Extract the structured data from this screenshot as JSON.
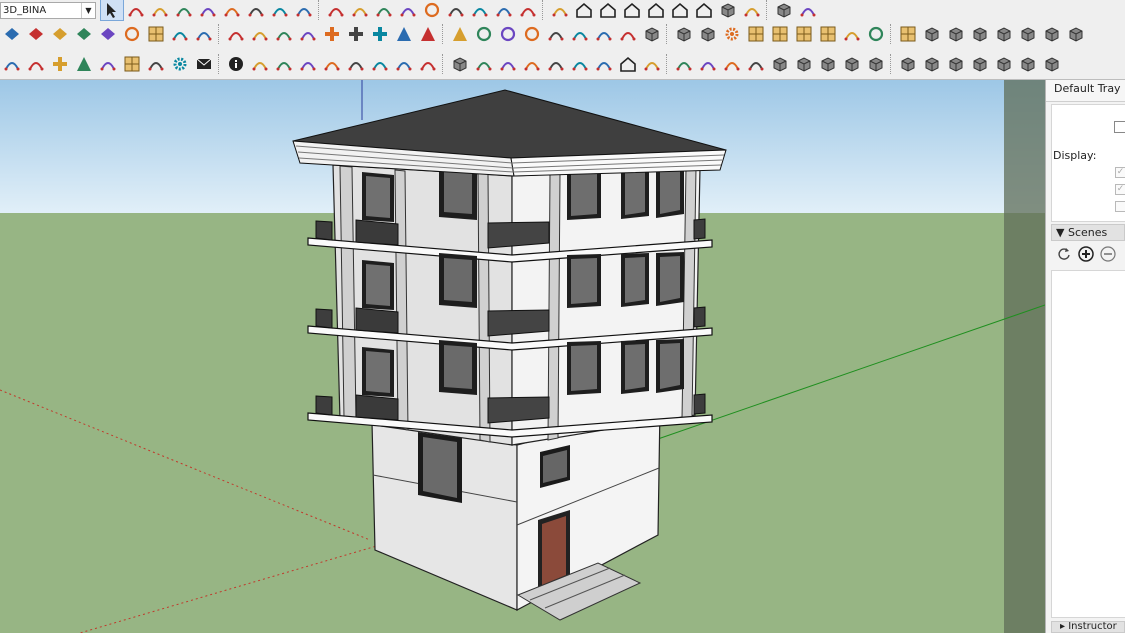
{
  "toolbar": {
    "layer_value": "3D_BINA",
    "row1_icons": [
      "select-icon",
      "eraser-icon",
      "pencil-line-icon",
      "arc-icon",
      "paint-bucket-icon",
      "push-pull-icon",
      "move-icon",
      "rotate-icon",
      "offset-icon",
      "tape-measure-icon",
      "protractor-icon",
      "text-icon",
      "axes-icon",
      "orbit-icon",
      "pan-icon",
      "zoom-icon",
      "zoom-extents-icon",
      "section-plane-icon",
      "styles-icon",
      "iso-view-icon",
      "top-view-icon",
      "front-view-icon",
      "right-view-icon",
      "back-view-icon",
      "left-view-icon",
      "layers-icon",
      "solid-tools-icon",
      "sandbox-icon",
      "paint-icon"
    ],
    "row2_icons": [
      "diamond-icon",
      "diamond-icon",
      "diamond-icon",
      "diamond-icon",
      "diamond-icon",
      "ring-icon",
      "table-icon",
      "copy-icon",
      "copy-icon",
      "weld-icon",
      "magnet-icon",
      "bracket-icon",
      "curve-icon",
      "cross-icon",
      "cross-icon",
      "cross-icon",
      "cone-icon",
      "cone-icon",
      "triangle-icon",
      "spiral-icon",
      "spiral-icon",
      "spiral-icon",
      "star-icon",
      "cylinder-icon",
      "undo-curve-icon",
      "puzzle-icon",
      "box-icon",
      "box-icon",
      "box-icon",
      "gear-icon",
      "grid-icon",
      "grid-icon",
      "grid-icon",
      "grid-icon",
      "dots-icon",
      "circle-dots-icon",
      "grid-icon",
      "stack-icon",
      "stack-icon",
      "stack-icon",
      "stack-icon",
      "stack-icon",
      "stack-icon",
      "stack-icon"
    ],
    "row3_icons": [
      "refresh-icon",
      "arrows-icon",
      "plus-icon",
      "tree-icon",
      "sun-icon",
      "checker-icon",
      "cloud-icon",
      "gear-icon",
      "mail-icon",
      "info-icon",
      "nodes-icon",
      "nodes-icon",
      "nodes-icon",
      "knife-icon",
      "flower-icon",
      "fish-icon",
      "pipe-icon",
      "curve-icon",
      "box-icon",
      "shell-icon",
      "bend-icon",
      "corner-icon",
      "corner-icon",
      "line-icon",
      "fill-icon",
      "house-icon",
      "stair-icon",
      "bird-icon",
      "hand-icon",
      "leaf-icon",
      "leaf-icon",
      "stack-icon",
      "stack-icon",
      "stack-icon",
      "stack-icon",
      "stack-icon",
      "stack-icon",
      "stack-icon",
      "stack-icon",
      "stack-icon",
      "stack-icon",
      "stack-icon",
      "stack-icon"
    ]
  },
  "tray": {
    "title": "Default Tray",
    "display_label": "Display:",
    "scenes_label": "Scenes",
    "instructor_label": "Instructor",
    "scene_icons": [
      "refresh-icon",
      "add-icon",
      "remove-icon"
    ]
  },
  "colors": {
    "sky_top": "#9dc7e6",
    "sky_bottom": "#e1eff8",
    "ground": "#97b584",
    "wall_light": "#f0f0f0",
    "wall_shade": "#d9d9d9",
    "roof": "#4a4a4a",
    "glass": "#5a5a5a",
    "door": "#8b4a3a",
    "axis_red": "#c0392b",
    "axis_green": "#1f8f1f",
    "axis_blue": "#2c3e9c"
  }
}
